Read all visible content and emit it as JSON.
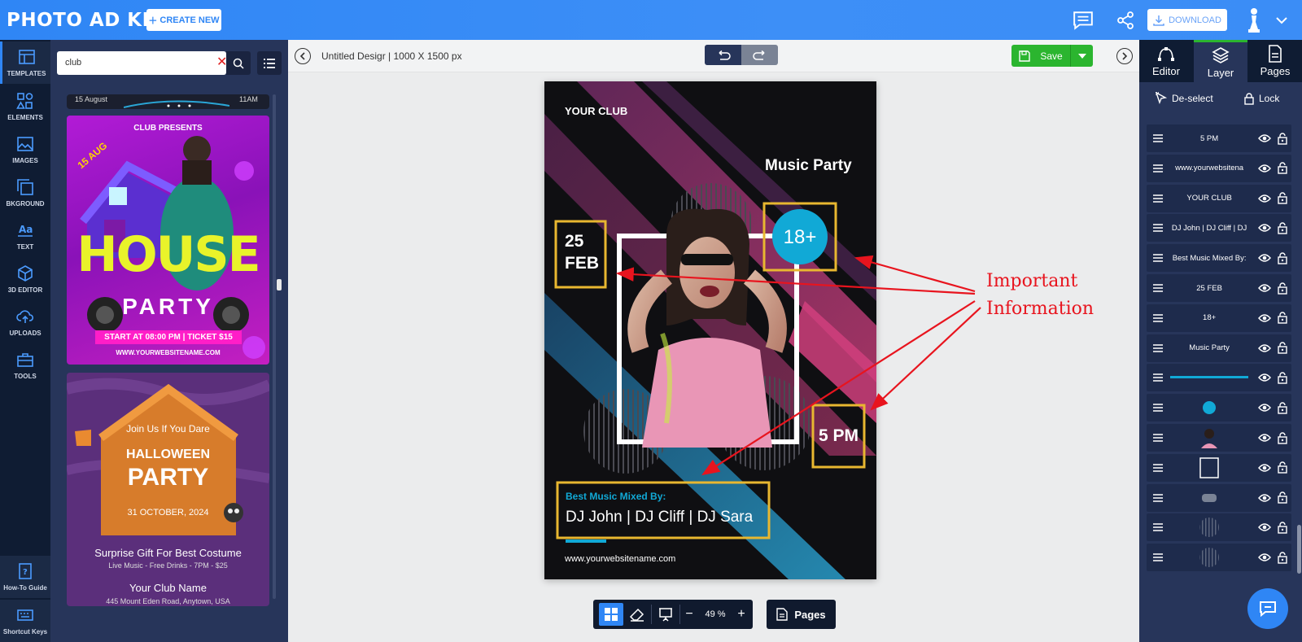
{
  "topbar": {
    "logo": "PHOTO AD KING",
    "create_new": "CREATE NEW",
    "download": "DOWNLOAD"
  },
  "left_nav": [
    {
      "label": "TEMPLATES",
      "icon": "templates-icon"
    },
    {
      "label": "ELEMENTS",
      "icon": "elements-icon"
    },
    {
      "label": "IMAGES",
      "icon": "images-icon"
    },
    {
      "label": "BKGROUND",
      "icon": "background-icon"
    },
    {
      "label": "TEXT",
      "icon": "text-icon"
    },
    {
      "label": "3D EDITOR",
      "icon": "3d-editor-icon"
    },
    {
      "label": "UPLOADS",
      "icon": "uploads-icon"
    },
    {
      "label": "TOOLS",
      "icon": "tools-icon"
    },
    {
      "label": "How-To Guide",
      "icon": "guide-icon"
    },
    {
      "label": "Shortcut Keys",
      "icon": "keyboard-icon"
    }
  ],
  "search": {
    "value": "club"
  },
  "templates": {
    "partial_top": {
      "date": "15 August",
      "time": "11AM"
    },
    "house_party": {
      "presents": "CLUB PRESENTS",
      "date": "15 AUG",
      "title_1": "HOUSE",
      "title_2": "PARTY",
      "ticket": "START AT 08:00 PM | TICKET $15",
      "website": "WWW.YOURWEBSITENAME.COM"
    },
    "halloween": {
      "line1": "Join Us If You Dare",
      "line2": "HALLOWEEN",
      "line3": "PARTY",
      "date": "31 OCTOBER, 2024",
      "gift": "Surprise Gift For Best Costume",
      "details": "Live Music - Free Drinks - 7PM - $25",
      "club": "Your Club Name",
      "address": "445 Mount Eden Road, Anytown, USA"
    }
  },
  "canvas": {
    "title": "Untitled Desigr",
    "size": "| 1000 X 1500 px",
    "save": "Save",
    "zoom": "49 %",
    "pages": "Pages"
  },
  "poster": {
    "club": "YOUR CLUB",
    "title": "Music Party",
    "age": "18+",
    "day": "25",
    "month": "FEB",
    "time": "5 PM",
    "mixed_by": "Best Music Mixed By:",
    "djs": "DJ John | DJ Cliff | DJ Sara",
    "website": "www.yourwebsitename.com"
  },
  "annotation": {
    "line1": "Important",
    "line2": "Information"
  },
  "right_panel": {
    "tabs": [
      "Editor",
      "Layer",
      "Pages"
    ],
    "deselect": "De-select",
    "lock": "Lock",
    "layers": [
      {
        "label": "5 PM",
        "kind": "text"
      },
      {
        "label": "www.yourwebsitena",
        "kind": "text"
      },
      {
        "label": "YOUR CLUB",
        "kind": "text"
      },
      {
        "label": "DJ John | DJ Cliff | DJ",
        "kind": "text"
      },
      {
        "label": "Best Music Mixed By:",
        "kind": "text"
      },
      {
        "label": "25 FEB",
        "kind": "text"
      },
      {
        "label": "18+",
        "kind": "text"
      },
      {
        "label": "Music Party",
        "kind": "text"
      },
      {
        "label": "",
        "kind": "line"
      },
      {
        "label": "",
        "kind": "circle"
      },
      {
        "label": "",
        "kind": "photo"
      },
      {
        "label": "",
        "kind": "frame"
      },
      {
        "label": "",
        "kind": "pill"
      },
      {
        "label": "",
        "kind": "stripe-circle"
      },
      {
        "label": "",
        "kind": "stripe-circle"
      }
    ]
  },
  "colors": {
    "topbar": "#2f86f5",
    "nav_bg": "#0f1c33",
    "panel_bg": "#27355a",
    "save_green": "#2bb52f",
    "poster_accent": "#e8b730",
    "poster_cyan": "#11a9d6",
    "annotation_red": "#e8141e"
  }
}
